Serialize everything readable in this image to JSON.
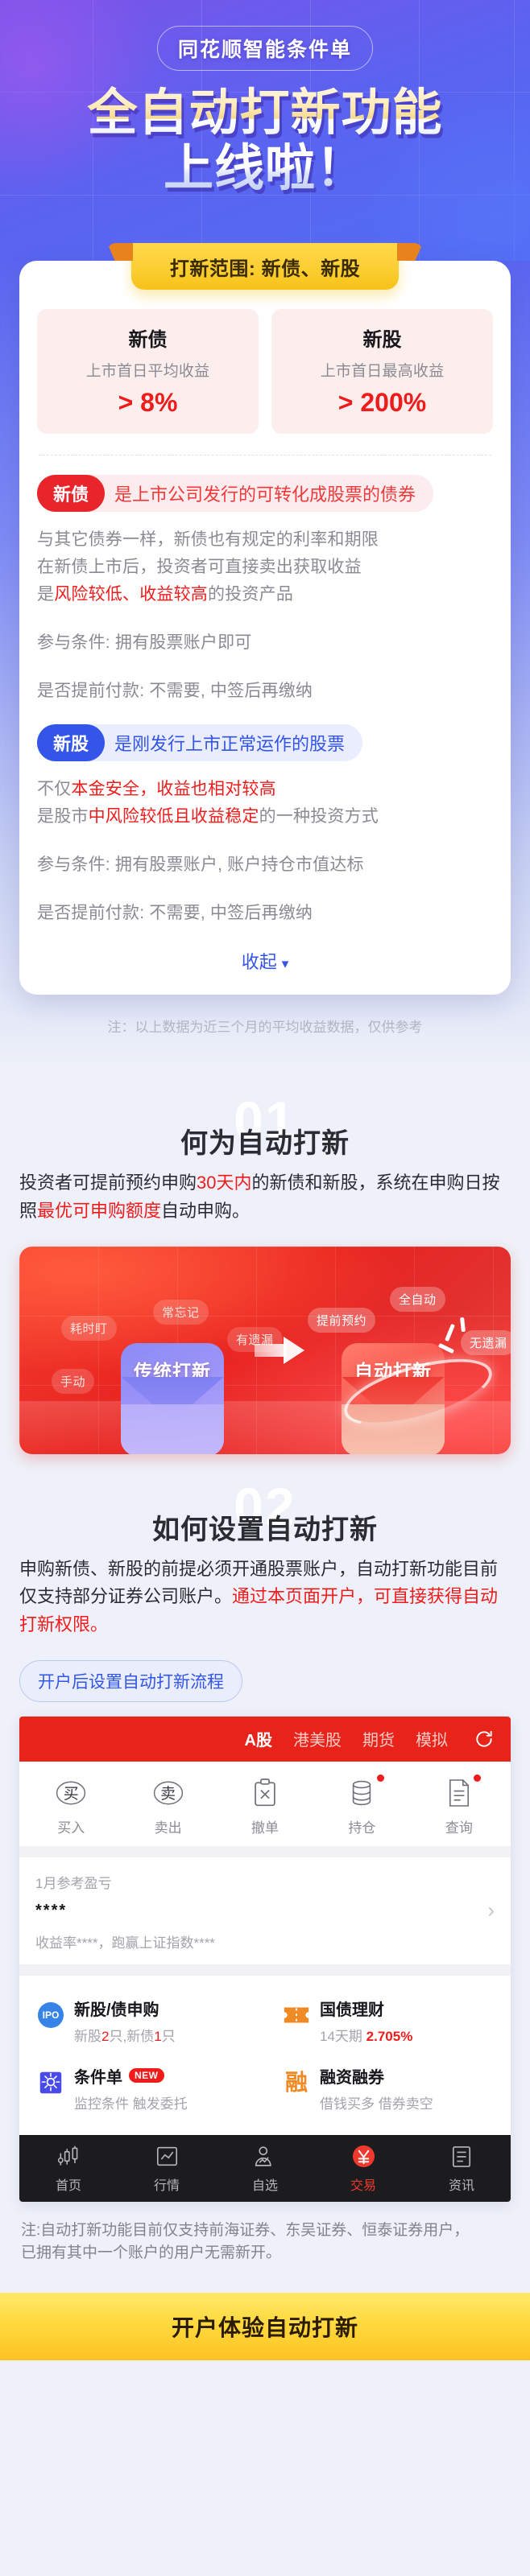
{
  "hero": {
    "badge": "同花顺智能条件单",
    "title_line1": "全自动打新功能",
    "title_line2": "上线啦！"
  },
  "card": {
    "ribbon": "打新范围: 新债、新股",
    "stats": [
      {
        "title": "新债",
        "subtitle": "上市首日平均收益",
        "value": "> 8%"
      },
      {
        "title": "新股",
        "subtitle": "上市首日最高收益",
        "value": "> 200%"
      }
    ],
    "bond": {
      "chip": "新债",
      "tagline": "是上市公司发行的可转化成股票的债券",
      "line1": "与其它债券一样，新债也有规定的利率和期限",
      "line2": "在新债上市后，投资者可直接卖出获取收益",
      "line3_pre": "是",
      "line3_hl1": "风险较低、收益较高",
      "line3_post": "的投资产品",
      "cond": "参与条件: 拥有股票账户即可",
      "prepay": "是否提前付款: 不需要, 中签后再缴纳"
    },
    "stock": {
      "chip": "新股",
      "tagline": "是刚发行上市正常运作的股票",
      "line1_pre": "不仅",
      "line1_hl": "本金安全，收益也相对较高",
      "line2_pre": "是股市",
      "line2_hl": "中风险较低且收益稳定",
      "line2_post": "的一种投资方式",
      "cond": "参与条件: 拥有股票账户, 账户持仓市值达标",
      "prepay": "是否提前付款: 不需要, 中签后再缴纳"
    },
    "collapse_label": "收起",
    "collapse_icon": "chevron-down-icon",
    "note": "注：以上数据为近三个月的平均收益数据，仅供参考"
  },
  "section1": {
    "watermark": "01",
    "title": "何为自动打新",
    "body_pre": "投资者可提前预约申购",
    "body_hl1": "30天内",
    "body_mid": "的新债和新股，系统在申购日按照",
    "body_hl2": "最优可申购额度",
    "body_post": "自动申购。",
    "compare": {
      "old_labels": [
        "耗时盯",
        "常忘记",
        "有遗漏",
        "手动"
      ],
      "old_title": "传统打新",
      "old_mark": "✕",
      "new_labels": [
        "提前预约",
        "全自动",
        "无遗漏"
      ],
      "new_title": "自动打新",
      "new_mark": "✓"
    }
  },
  "section2": {
    "watermark": "02",
    "title": "如何设置自动打新",
    "body_pre": "申购新债、新股的前提必须开通股票账户，自动打新功能目前仅支持部分证券公司账户。",
    "body_hl": "通过本页面开户，可直接获得自动打新权限。",
    "flow_pill": "开户后设置自动打新流程"
  },
  "app": {
    "top_tabs": [
      {
        "label": "A股",
        "active": true
      },
      {
        "label": "港美股",
        "active": false
      },
      {
        "label": "期货",
        "active": false
      },
      {
        "label": "模拟",
        "active": false
      }
    ],
    "refresh_icon": "refresh-icon",
    "actions": [
      {
        "icon": "buy-circle-icon",
        "glyph": "买",
        "label": "买入",
        "dot": false
      },
      {
        "icon": "sell-circle-icon",
        "glyph": "卖",
        "label": "卖出",
        "dot": false
      },
      {
        "icon": "cancel-order-icon",
        "glyph": "✕",
        "label": "撤单",
        "dot": false
      },
      {
        "icon": "holdings-icon",
        "glyph": "",
        "label": "持仓",
        "dot": true
      },
      {
        "icon": "query-doc-icon",
        "glyph": "",
        "label": "查询",
        "dot": true
      }
    ],
    "pnl": {
      "title": "1月参考盈亏",
      "value": "****",
      "detail": "收益率****，跑赢上证指数****",
      "chevron_icon": "chevron-right-icon"
    },
    "grid": [
      {
        "icon": "ipo-icon",
        "icon_text": "IPO",
        "title": "新股/债申购",
        "badge": "",
        "sub_pre": "新股",
        "sub_n1": "2",
        "sub_mid": "只,新债",
        "sub_n2": "1",
        "sub_post": "只"
      },
      {
        "icon": "treasury-ticket-icon",
        "icon_text": "",
        "title": "国债理财",
        "badge": "",
        "sub_pre": "14天期",
        "sub_n1": "2.705%",
        "sub_mid": "",
        "sub_n2": "",
        "sub_post": ""
      },
      {
        "icon": "condition-order-icon",
        "icon_text": "",
        "title": "条件单",
        "badge": "NEW",
        "sub_pre": "监控条件 触发委托",
        "sub_n1": "",
        "sub_mid": "",
        "sub_n2": "",
        "sub_post": ""
      },
      {
        "icon": "margin-trading-icon",
        "icon_text": "融",
        "title": "融资融券",
        "badge": "",
        "sub_pre": "借钱买多 借券卖空",
        "sub_n1": "",
        "sub_mid": "",
        "sub_n2": "",
        "sub_post": ""
      }
    ],
    "tabbar": [
      {
        "icon": "home-candlestick-icon",
        "label": "首页",
        "active": false
      },
      {
        "icon": "quotes-chart-icon",
        "label": "行情",
        "active": false
      },
      {
        "icon": "watchlist-person-icon",
        "label": "自选",
        "active": false
      },
      {
        "icon": "trade-yen-icon",
        "label": "交易",
        "active": true
      },
      {
        "icon": "news-doc-icon",
        "label": "资讯",
        "active": false
      }
    ]
  },
  "footer": {
    "note_line1": "注:自动打新功能目前仅支持前海证券、东吴证券、恒泰证券用户，",
    "note_line2": "已拥有其中一个账户的用户无需新开。",
    "cta": "开户体验自动打新"
  },
  "colors": {
    "brand_red": "#e8231a",
    "highlight_red": "#f01b1b",
    "brand_blue": "#3355e8",
    "gold": "#fcc321",
    "hero_purple": "#5a63f0"
  }
}
